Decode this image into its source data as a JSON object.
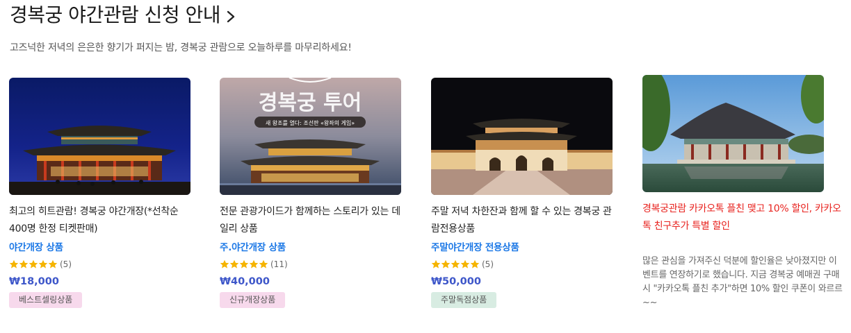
{
  "header": {
    "title": "경복궁 야간관람 신청 안내",
    "subtitle": "고즈넉한 저녁의 은은한 향기가 퍼지는 밤, 경복궁 관람으로 오늘하루를 마무리하세요!"
  },
  "products": [
    {
      "title": "최고의 히트관람! 경복궁 야간개장(*선착순 400명 한정 티켓판매)",
      "category": "야간개장 상품",
      "rating": 5,
      "review_count": "(5)",
      "price": "₩18,000",
      "badge": "베스트셀링상품",
      "badge_color": "#f7d9ec"
    },
    {
      "title": "전문 관광가이드가 함께하는 스토리가 있는 데일리 상품",
      "category": "주.야간개장 상품",
      "rating": 5,
      "review_count": "(11)",
      "price": "₩40,000",
      "badge": "신규개장상품",
      "badge_color": "#f7d9ec",
      "image_text": {
        "headline": "경복궁 투어",
        "caption": "새 왕조를 열다: 조선판 «왕좌의 게임»"
      }
    },
    {
      "title": "주말 저녁 차한잔과 함께 할 수 있는 경복궁 관람전용상품",
      "category": "주말야간개장 전용상품",
      "rating": 5,
      "review_count": "(5)",
      "price": "₩50,000",
      "badge": "주말독점상품",
      "badge_color": "#d8ece2"
    }
  ],
  "promo": {
    "title": "경복궁관람 카카오톡 플친 맺고 10% 할인, 카카오톡 친구추가 특별 할인",
    "description": "많은 관심을 가져주신 덕분에 할인율은 낮아졌지만 이벤트를 연장하기로 했습니다. 지금 경복궁 예매권 구매 시 \"카카오톡 플친 추가\"하면 10% 할인 쿠폰이 와르르~~"
  },
  "colors": {
    "accent_blue": "#1c78e6",
    "price_blue": "#3d56c9",
    "promo_red": "#e8231f",
    "star": "#f5b400"
  }
}
